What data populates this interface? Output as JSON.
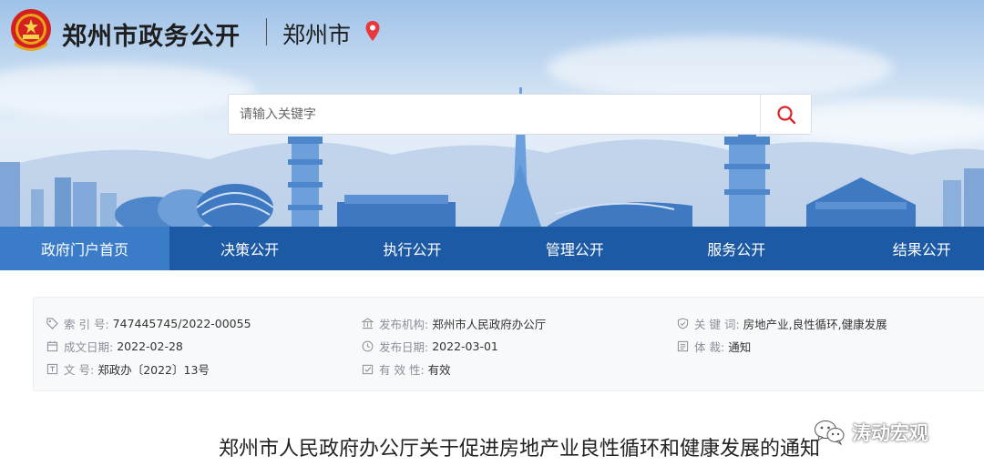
{
  "header": {
    "site_title": "郑州市政务公开",
    "city": "郑州市"
  },
  "search": {
    "placeholder": "请输入关键字"
  },
  "nav": {
    "items": [
      {
        "label": "政府门户首页"
      },
      {
        "label": "决策公开"
      },
      {
        "label": "执行公开"
      },
      {
        "label": "管理公开"
      },
      {
        "label": "服务公开"
      },
      {
        "label": "结果公开"
      }
    ]
  },
  "meta": {
    "index_no": {
      "label": "索 引 号:",
      "value": "747445745/2022-00055"
    },
    "issuer": {
      "label": "发布机构:",
      "value": "郑州市人民政府办公厅"
    },
    "keywords": {
      "label": "关  键  词:",
      "value": "房地产业,良性循环,健康发展"
    },
    "written_date": {
      "label": "成文日期:",
      "value": "2022-02-28"
    },
    "publish_date": {
      "label": "发布日期:",
      "value": "2022-03-01"
    },
    "genre": {
      "label": "体      裁:",
      "value": "通知"
    },
    "doc_no": {
      "label": "文      号:",
      "value": "郑政办〔2022〕13号"
    },
    "validity": {
      "label": "有 效 性:",
      "value": "有效"
    }
  },
  "article": {
    "title": "郑州市人民政府办公厅关于促进房地产业良性循环和健康发展的通知"
  },
  "watermark": {
    "text": "涛动宏观"
  },
  "colors": {
    "nav_bg": "#1d5aa6",
    "nav_active": "#3a7cc8",
    "pin": "#e8383d",
    "search_icon": "#d9262c"
  }
}
